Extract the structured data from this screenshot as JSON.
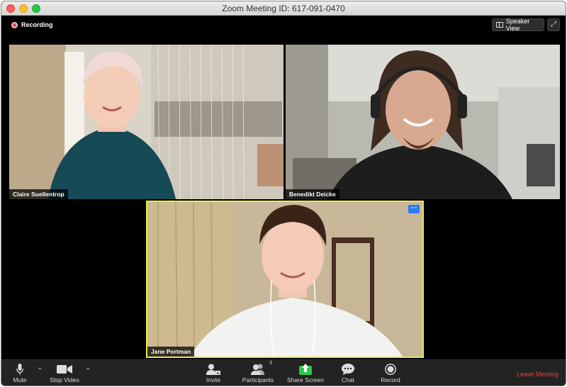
{
  "window": {
    "title": "Zoom Meeting ID: 617-091-0470"
  },
  "topbar": {
    "recording_label": "Recording",
    "speaker_view_label": "Speaker View"
  },
  "participants": [
    {
      "name": "Claire Suellentrop"
    },
    {
      "name": "Benedikt Deicke"
    },
    {
      "name": "Jane Portman",
      "active_speaker": true
    }
  ],
  "toolbar": {
    "mute_label": "Mute",
    "stop_video_label": "Stop Video",
    "invite_label": "Invite",
    "participants_label": "Participants",
    "participants_count": "3",
    "share_screen_label": "Share Screen",
    "chat_label": "Chat",
    "record_label": "Record",
    "leave_label": "Leave Meeting"
  },
  "colors": {
    "active_speaker_border": "#e6e650",
    "share_screen_green": "#2ac84a",
    "leave_red": "#e0443e",
    "recording_red": "#e0443e"
  }
}
